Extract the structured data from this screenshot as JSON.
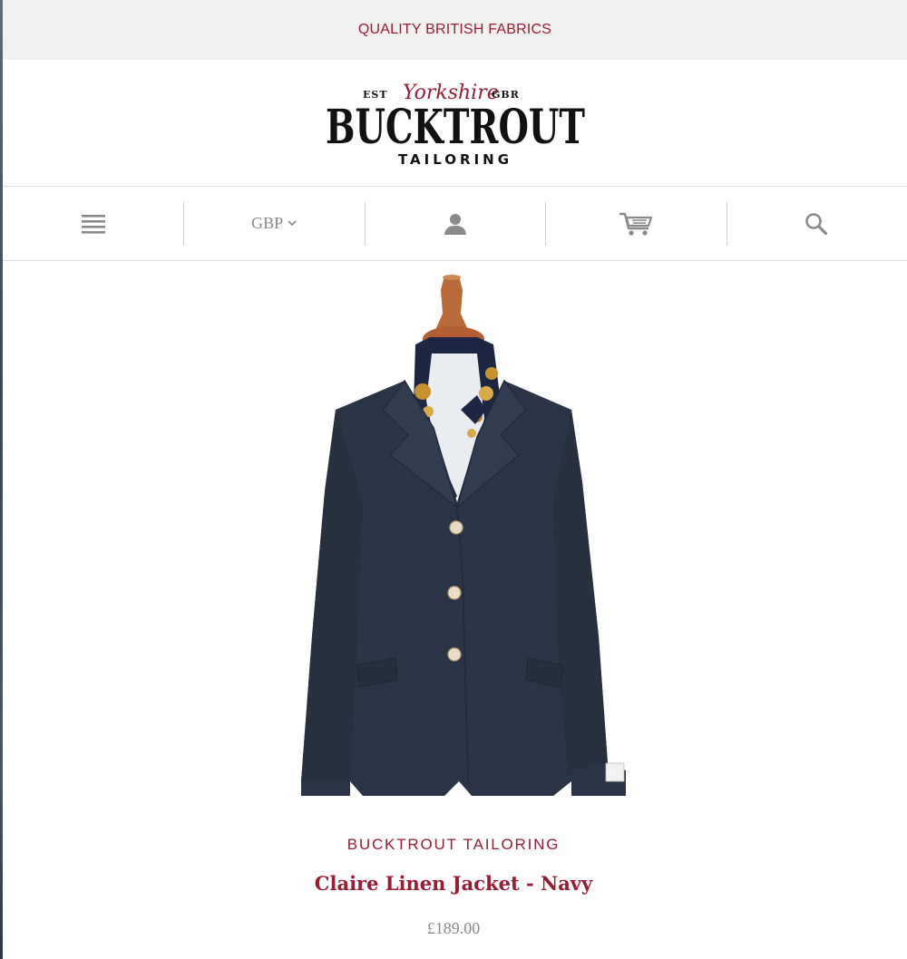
{
  "announcement": {
    "text": "QUALITY BRITISH FABRICS"
  },
  "logo": {
    "est": "EST",
    "script": "Yorkshire",
    "gbr": "GBR",
    "main": "BUCKTROUT",
    "sub": "TAILORING"
  },
  "nav": {
    "menu_icon": "hamburger-icon",
    "currency": "GBP",
    "account_icon": "user-icon",
    "cart_icon": "cart-icon",
    "search_icon": "search-icon"
  },
  "product": {
    "image_description": "navy-jacket-on-mannequin",
    "brand": "BUCKTROUT TAILORING",
    "title": "Claire Linen Jacket - Navy",
    "price": "£189.00"
  },
  "colors": {
    "accent": "#9b1b30",
    "announcement_bg": "#f1f1f1",
    "icon_gray": "#8a8a8a",
    "jacket_navy": "#2b3446"
  }
}
